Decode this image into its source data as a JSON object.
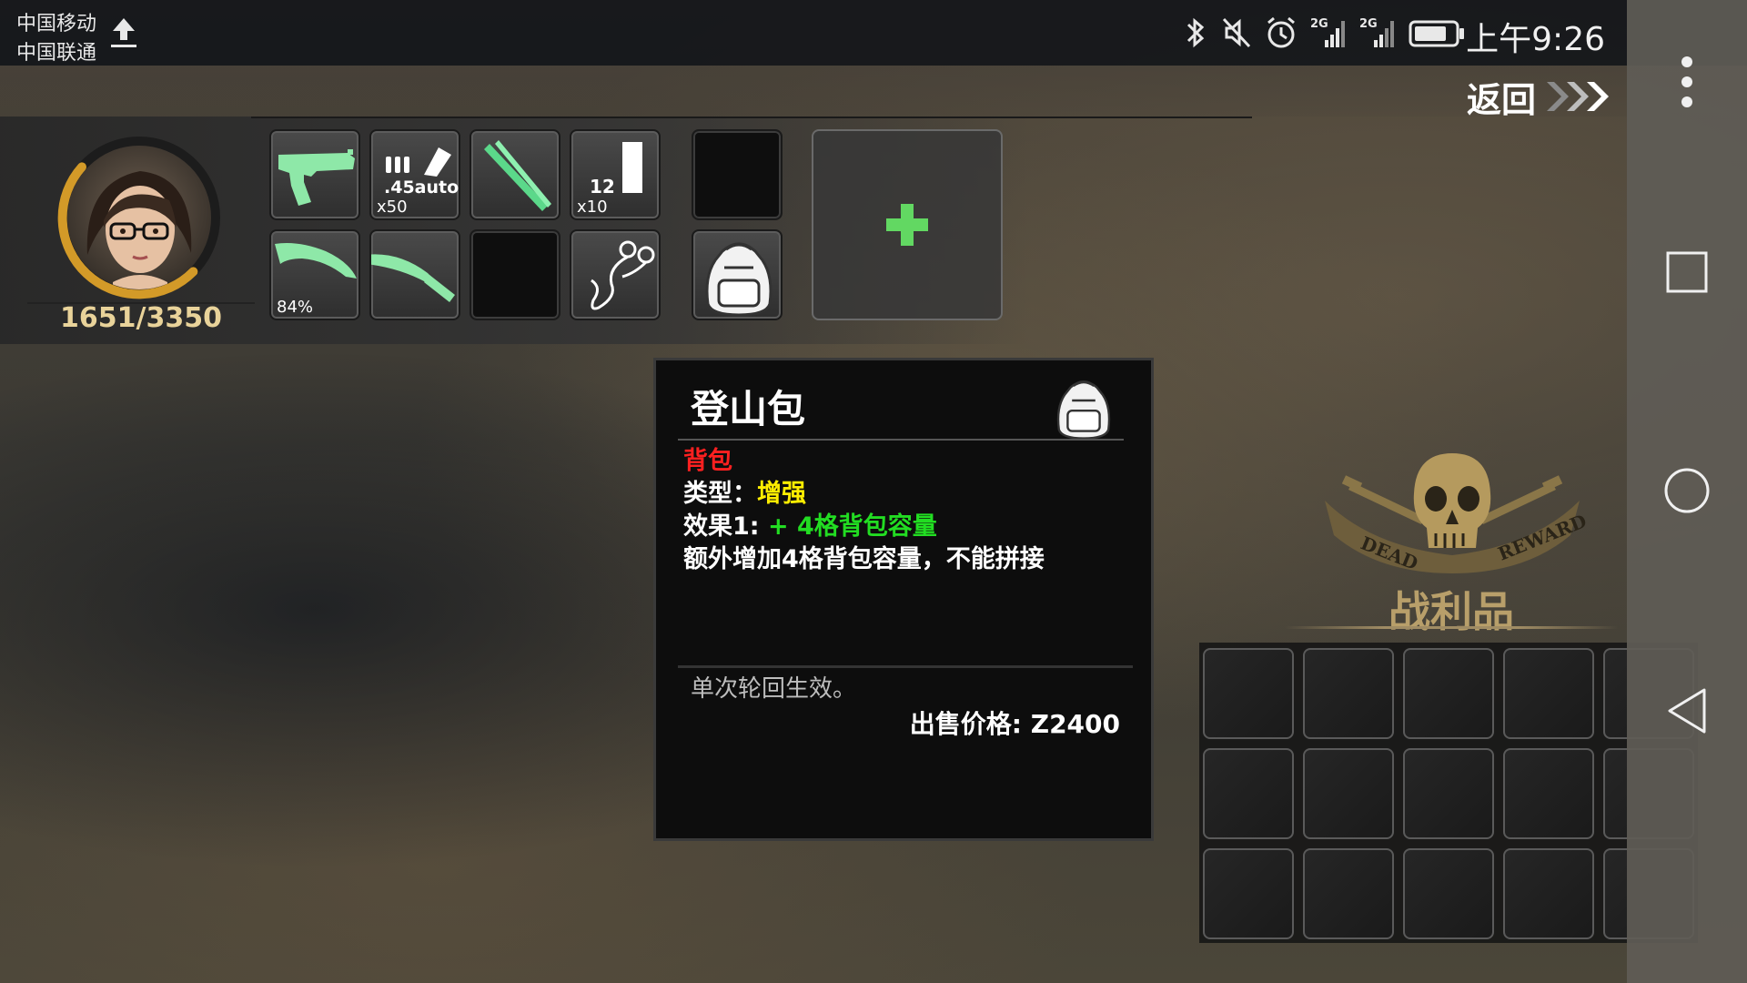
{
  "status_bar": {
    "carrier_1": "中国移动",
    "carrier_2": "中国联通",
    "time": "上午9:26",
    "icons": [
      "upload-icon",
      "bluetooth-icon",
      "mute-icon",
      "alarm-icon",
      "signal-2g-icon",
      "signal-2g-icon",
      "battery-icon"
    ],
    "network_1": "2G",
    "network_2": "2G"
  },
  "header": {
    "back_label": "返回"
  },
  "player": {
    "hp_text": "1651/3350",
    "hp_fraction": 0.49
  },
  "equipment": {
    "slots_row1": [
      {
        "item": "pistol-icon",
        "count": ""
      },
      {
        "item": "ammo-45auto-icon",
        "label": ".45auto",
        "count": "x50"
      },
      {
        "item": "crossed-sticks-icon",
        "count": ""
      },
      {
        "item": "ammo-12-icon",
        "label": "12",
        "count": "x10"
      }
    ],
    "slots_row2": [
      {
        "item": "machete-icon",
        "count": "84%"
      },
      {
        "item": "knife-icon",
        "count": ""
      },
      {
        "item": "empty",
        "count": ""
      },
      {
        "item": "earphones-icon",
        "count": ""
      }
    ],
    "bag_slots": [
      "empty",
      "backpack-icon"
    ],
    "add_slot_icon": "plus-icon"
  },
  "tooltip": {
    "title": "登山包",
    "category": "背包",
    "type_label": "类型：",
    "type_value": "增强",
    "effect_label": "效果1:",
    "effect_value": "+ 4格背包容量",
    "description": "额外增加4格背包容量，不能拼接",
    "note": "单次轮回生效。",
    "price_label": "出售价格: ",
    "price_currency": "Z",
    "price_value": "2400",
    "colors": {
      "category": "#ff2020",
      "type_value": "#ffee00",
      "effect_value": "#22dd22"
    }
  },
  "loot": {
    "title": "战利品",
    "emblem_text_left": "DEAD",
    "emblem_text_right": "REWARD",
    "rows": 3,
    "cols": 5
  },
  "nav": {
    "icons": [
      "more-vert-icon",
      "recents-square-icon",
      "home-circle-icon",
      "back-triangle-icon"
    ]
  }
}
